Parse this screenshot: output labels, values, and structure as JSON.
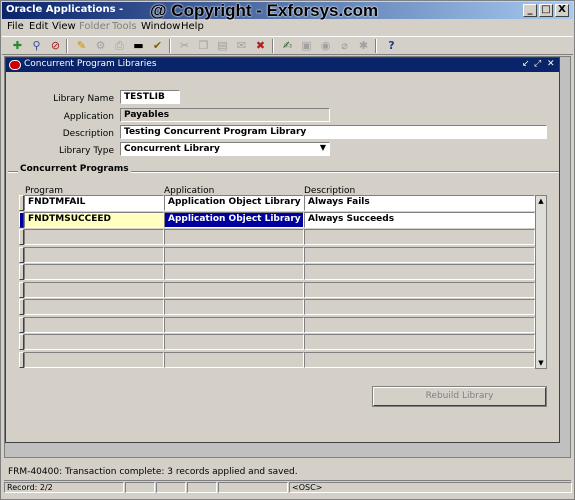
{
  "window": {
    "title": "Oracle Applications -",
    "watermark": "@ Copyright - Exforsys.com",
    "min_label": "_",
    "max_label": "□",
    "close_label": "X"
  },
  "menu": {
    "items": [
      {
        "label": "File",
        "enabled": true
      },
      {
        "label": "Edit",
        "enabled": true
      },
      {
        "label": "View",
        "enabled": true
      },
      {
        "label": "Folder",
        "enabled": false
      },
      {
        "label": "Tools",
        "enabled": false
      },
      {
        "label": "Window",
        "enabled": true
      },
      {
        "label": "Help",
        "enabled": true
      }
    ]
  },
  "toolbar": {
    "icons": [
      "new-record-icon",
      "find-icon",
      "clear-icon",
      "lov-icon",
      "navigator-icon",
      "print-icon",
      "zoom-icon",
      "cut-icon",
      "copy-icon",
      "paste-icon",
      "new-icon",
      "delete-icon",
      "edit-field-icon",
      "folder-icon",
      "translations-icon",
      "attachments-icon",
      "zoom-tool-icon",
      "help-icon"
    ]
  },
  "form": {
    "title": "Concurrent Program Libraries",
    "library_name_label": "Library Name",
    "library_name": "TESTLIB",
    "application_label": "Application",
    "application": "Payables",
    "description_label": "Description",
    "description": "Testing Concurrent Program Library",
    "library_type_label": "Library Type",
    "library_type": "Concurrent Library",
    "section_title": "Concurrent Programs",
    "columns": [
      "Program",
      "Application",
      "Description"
    ],
    "rows": [
      {
        "program": "FNDTMFAIL",
        "application": "Application Object Library",
        "description": "Always Fails"
      },
      {
        "program": "FNDTMSUCCEED",
        "application": "Application Object Library",
        "description": "Always Succeeds"
      }
    ],
    "rebuild_button": "Rebuild Library"
  },
  "status": {
    "message": "FRM-40400: Transaction complete: 3 records applied and saved.",
    "record": "Record: 2/2",
    "osc": "<OSC>"
  },
  "colors": {
    "title_bar": "#0a246a",
    "current_record_field": "#ffffc0",
    "selection": "#0000a0"
  }
}
